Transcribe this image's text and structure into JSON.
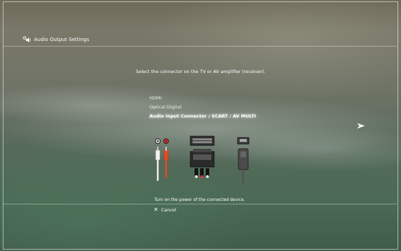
{
  "header": {
    "icon": "speaker-settings-icon",
    "title": "Audio Output Settings"
  },
  "prompt": "Select the connector on the TV or AV amplifier (receiver).",
  "options": [
    {
      "label": "HDMI",
      "selected": false
    },
    {
      "label": "Optical Digital",
      "selected": false
    },
    {
      "label": "Audio Input Connector / SCART / AV MULTI",
      "selected": true
    }
  ],
  "next_icon": "right-arrow-icon",
  "connector_icons": [
    "rca-audio-connector-icon",
    "scart-connector-icon",
    "av-multi-connector-icon"
  ],
  "hint": "Turn on the power of the connected device.",
  "footer": {
    "cancel_icon": "cross-button-icon",
    "cancel_label": "Cancel"
  }
}
